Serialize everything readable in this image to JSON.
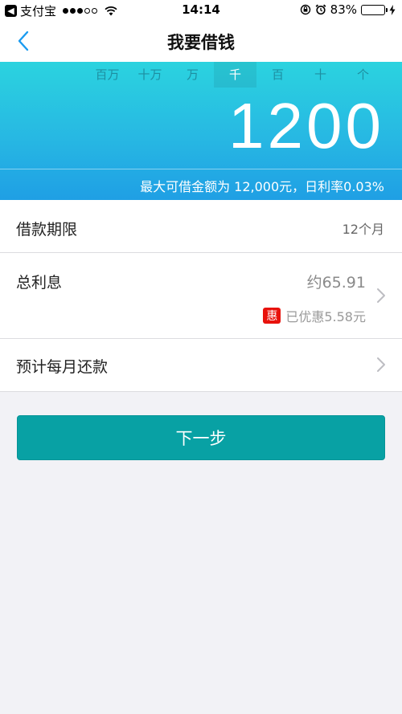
{
  "status_bar": {
    "back_app": "支付宝",
    "time": "14:14",
    "battery": "83%",
    "battery_level": 0.83
  },
  "nav": {
    "title": "我要借钱"
  },
  "amount": {
    "digit_columns": [
      "百万",
      "十万",
      "万",
      "千",
      "百",
      "十",
      "个"
    ],
    "active_column": "千",
    "value": "1200",
    "limit_text": "最大可借金额为 12,000元，日利率0.03%"
  },
  "list": {
    "term_label": "借款期限",
    "term_value": "12个月",
    "interest_label": "总利息",
    "interest_value": "约65.91",
    "discount_badge": "惠",
    "discount_text": "已优惠5.58元",
    "monthly_label": "预计每月还款"
  },
  "next_button": {
    "label": "下一步"
  },
  "colors": {
    "accent": "#08a1a4",
    "panel_top": "#2bd3df",
    "panel_bottom": "#1f9fe4",
    "discount_badge": "#e8120c",
    "back_arrow": "#1a9bf0"
  },
  "icons": {
    "back": "chevron-left-icon",
    "row_arrow": "chevron-right-icon"
  }
}
